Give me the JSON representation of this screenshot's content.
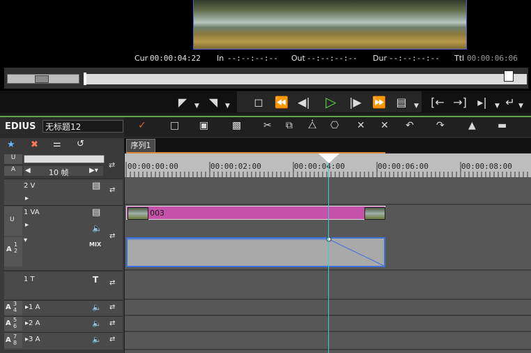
{
  "app": {
    "brand": "EDIUS",
    "project_name": "无标题12"
  },
  "timecodes": {
    "cur_label": "Cur",
    "cur_value": "00:00:04:22",
    "in_label": "In",
    "in_value": "--:--:--:--",
    "out_label": "Out",
    "out_value": "--:--:--:--",
    "dur_label": "Dur",
    "dur_value": "--:--:--:--",
    "ttl_label": "Ttl",
    "ttl_value": "00:00:06:06"
  },
  "sequence_tab": "序列1",
  "zoom": {
    "value": "10 帧"
  },
  "ruler": [
    "00:00:00:00",
    "00:00:02:00",
    "00:00:04:00",
    "00:00:06:00",
    "00:00:08:00"
  ],
  "tracks": {
    "v2": "2 V",
    "va1": "1 VA",
    "mix": "MIX",
    "t1": "1 T",
    "a1": "1 A",
    "a2": "2 A",
    "a3": "3 A",
    "a12_badge": "A",
    "a34_badge": "A",
    "a56_badge": "A",
    "a78_badge": "A"
  },
  "clip": {
    "name": "003"
  },
  "colors": {
    "accent_green": "#5ca84a",
    "clip_video": "#c452a8",
    "clip_audio_border": "#3f72d6",
    "playhead": "#28d8c8"
  }
}
